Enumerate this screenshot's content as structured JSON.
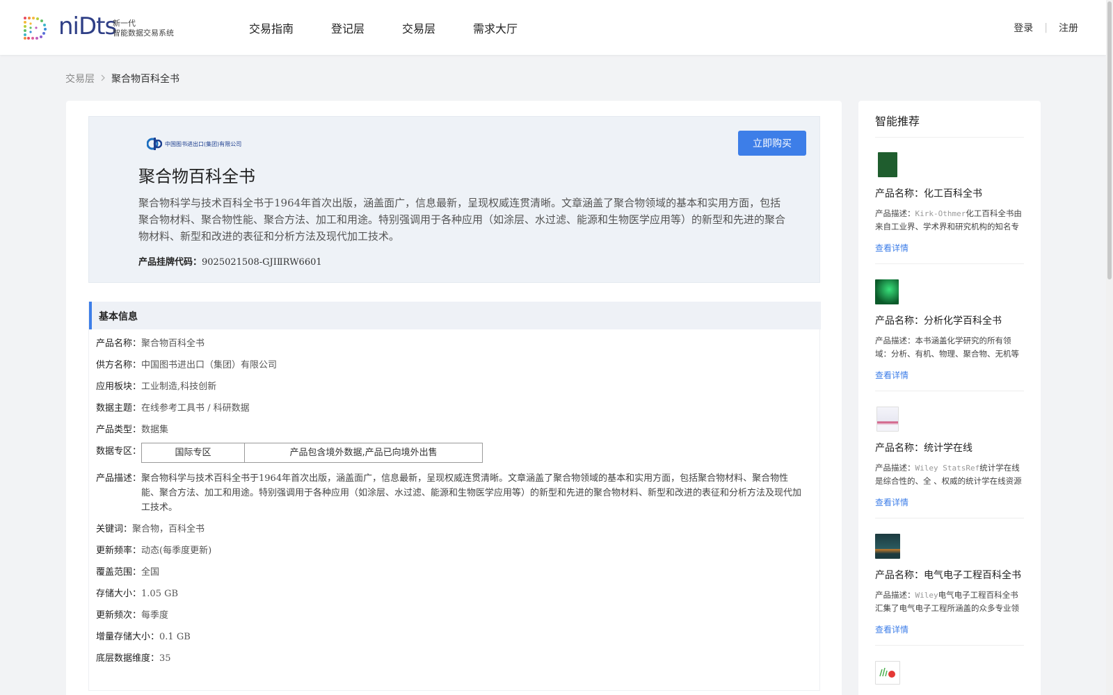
{
  "header": {
    "logo_word": "niDts",
    "logo_line1": "新一代",
    "logo_line2": "智能数据交易系统",
    "nav": [
      "交易指南",
      "登记层",
      "交易层",
      "需求大厅"
    ],
    "login": "登录",
    "separator": "|",
    "register": "注册"
  },
  "breadcrumb": {
    "parent": "交易层",
    "separator": ">",
    "current": "聚合物百科全书"
  },
  "hero": {
    "supplier_logo_text": "中国图书进出口(集团)有限公司",
    "buy_label": "立即购买",
    "title": "聚合物百科全书",
    "description": "聚合物科学与技术百科全书于1964年首次出版，涵盖面广，信息最新，呈现权威连贯清晰。文章涵盖了聚合物领域的基本和实用方面，包括聚合物材料、聚合物性能、聚合方法、加工和用途。特别强调用于各种应用（如涂层、水过滤、能源和生物医学应用等）的新型和先进的聚合物材料、新型和改进的表征和分析方法及现代加工技术。",
    "code_label": "产品挂牌代码：",
    "code_value": "9025021508-GJIⅡRW6601"
  },
  "info": {
    "section_title": "基本信息",
    "rows": [
      {
        "k": "产品名称：",
        "v": "聚合物百科全书"
      },
      {
        "k": "供方名称：",
        "v": "中国图书进出口（集团）有限公司"
      },
      {
        "k": "应用板块：",
        "v": "工业制造,科技创新"
      },
      {
        "k": "数据主题：",
        "v": "在线参考工具书 / 科研数据"
      },
      {
        "k": "产品类型：",
        "v": "数据集"
      }
    ],
    "zone_label": "数据专区：",
    "zone_cells": [
      "国际专区",
      "产品包含境外数据,产品已向境外出售"
    ],
    "desc_label": "产品描述：",
    "desc_value": "聚合物科学与技术百科全书于1964年首次出版，涵盖面广，信息最新，呈现权威连贯清晰。文章涵盖了聚合物领域的基本和实用方面，包括聚合物材料、聚合物性能、聚合方法、加工和用途。特别强调用于各种应用（如涂层、水过滤、能源和生物医学应用等）的新型和先进的聚合物材料、新型和改进的表征和分析方法及现代加工技术。",
    "rows2": [
      {
        "k": "关键词：",
        "v": "聚合物，百科全书"
      },
      {
        "k": "更新频率：",
        "v": "动态(每季度更新)"
      },
      {
        "k": "覆盖范围：",
        "v": "全国"
      },
      {
        "k": "存储大小：",
        "v": "1.05 GB"
      },
      {
        "k": "更新频次：",
        "v": "每季度"
      },
      {
        "k": "增量存储大小：",
        "v": "0.1 GB"
      },
      {
        "k": "底层数据维度：",
        "v": "35"
      }
    ]
  },
  "sidebar": {
    "title": "智能推荐",
    "items": [
      {
        "name": "产品名称：化工百科全书",
        "desc_prefix": "产品描述：",
        "desc_en": "Kirk-Othmer",
        "desc_rest": "化工百科全书由来自工业界、学术界和研究机构的知名专家撰写，内容全面",
        "more": "查看详情",
        "color": "#1f5d2e"
      },
      {
        "name": "产品名称：分析化学百科全书",
        "desc_prefix": "产品描述：",
        "desc_en": "",
        "desc_rest": "本书涵盖化学研究的所有领域：分析、有机、物理、聚合物、无机等",
        "more": "查看详情",
        "color": "#0f7a3a"
      },
      {
        "name": "产品名称：统计学在线",
        "desc_prefix": "产品描述：",
        "desc_en": "Wiley StatsRef",
        "desc_rest": "统计学在线是综合性的、全 、权威的统计学在线资源",
        "more": "查看详情",
        "color": "#d9d9e6"
      },
      {
        "name": "产品名称：电气电子工程百科全书",
        "desc_prefix": "产品描述：",
        "desc_en": "Wiley",
        "desc_rest": "电气电子工程百科全书汇集了电气电子工程所涵盖的众多专业领域",
        "more": "查看详情",
        "color": "#1c3a3f"
      }
    ]
  }
}
